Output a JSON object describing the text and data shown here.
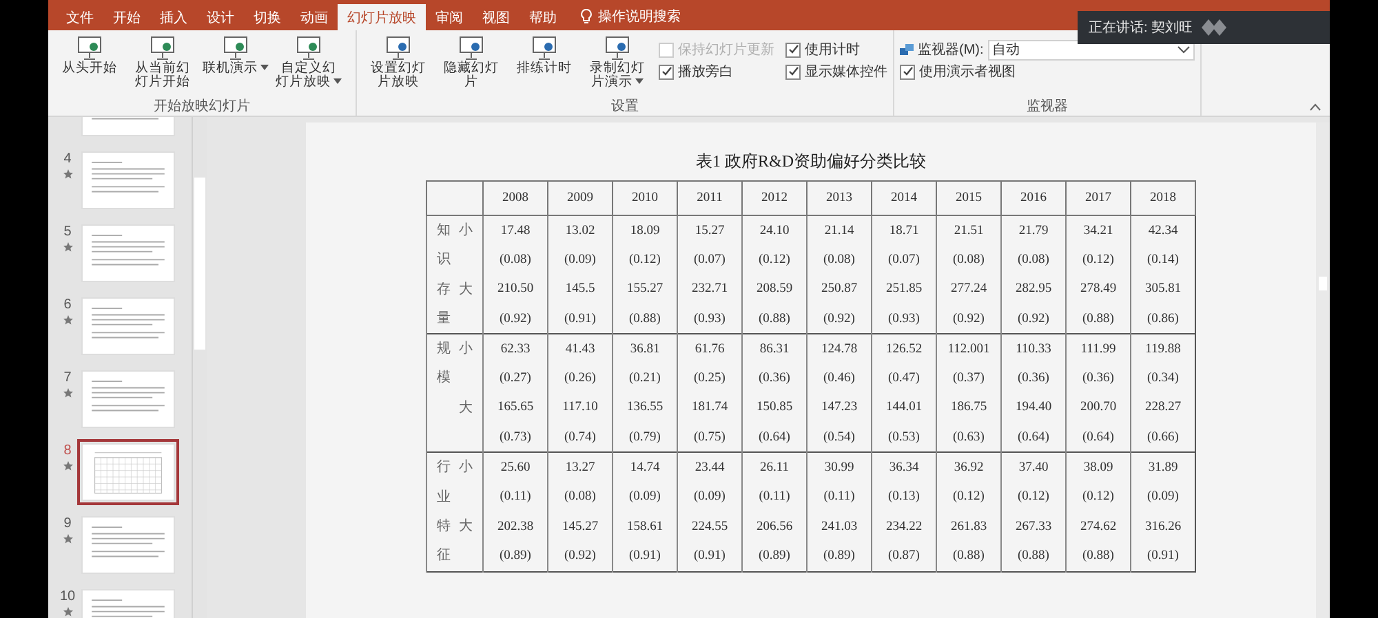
{
  "tabs": [
    {
      "label": "文件",
      "selected": false
    },
    {
      "label": "开始",
      "selected": false
    },
    {
      "label": "插入",
      "selected": false
    },
    {
      "label": "设计",
      "selected": false
    },
    {
      "label": "切换",
      "selected": false
    },
    {
      "label": "动画",
      "selected": false
    },
    {
      "label": "幻灯片放映",
      "selected": true
    },
    {
      "label": "审阅",
      "selected": false
    },
    {
      "label": "视图",
      "selected": false
    },
    {
      "label": "帮助",
      "selected": false
    }
  ],
  "search": {
    "placeholder": "操作说明搜索"
  },
  "speaking_tooltip": {
    "text": "正在讲话: 契刘旺"
  },
  "ribbon": {
    "groups": [
      {
        "label": "开始放映幻灯片",
        "items": [
          {
            "kind": "button",
            "label": "从头开始",
            "dropdown": false
          },
          {
            "kind": "button",
            "label": "从当前幻灯片开始",
            "dropdown": false
          },
          {
            "kind": "button",
            "label": "联机演示",
            "dropdown": true
          },
          {
            "kind": "button",
            "label": "自定义幻灯片放映",
            "dropdown": true
          }
        ]
      },
      {
        "label": "设置",
        "items": [
          {
            "kind": "button",
            "label": "设置幻灯片放映",
            "dropdown": false
          },
          {
            "kind": "button",
            "label": "隐藏幻灯片",
            "dropdown": false
          },
          {
            "kind": "button",
            "label": "排练计时",
            "dropdown": false
          },
          {
            "kind": "button",
            "label": "录制幻灯片演示",
            "dropdown": true
          },
          {
            "kind": "checkbox",
            "label": "保持幻灯片更新",
            "checked": false,
            "disabled": true
          },
          {
            "kind": "checkbox",
            "label": "播放旁白",
            "checked": true,
            "disabled": false
          },
          {
            "kind": "checkbox",
            "label": "使用计时",
            "checked": true,
            "disabled": false
          },
          {
            "kind": "checkbox",
            "label": "显示媒体控件",
            "checked": true,
            "disabled": false
          }
        ]
      },
      {
        "label": "监视器",
        "items": [
          {
            "kind": "select",
            "label": "监视器(M):",
            "value": "自动"
          },
          {
            "kind": "checkbox",
            "label": "使用演示者视图",
            "checked": true,
            "disabled": false
          }
        ]
      }
    ]
  },
  "thumbnails": [
    {
      "selected": false
    },
    {
      "number": "4",
      "selected": false
    },
    {
      "number": "5",
      "selected": false
    },
    {
      "number": "6",
      "selected": false
    },
    {
      "number": "7",
      "selected": false
    },
    {
      "number": "8",
      "selected": true
    },
    {
      "number": "9",
      "selected": false
    },
    {
      "number": "10",
      "selected": false
    }
  ],
  "slide": {
    "title": "表1 政府R&D资助偏好分类比较",
    "table": {
      "columns": [
        "2008",
        "2009",
        "2010",
        "2011",
        "2012",
        "2013",
        "2014",
        "2015",
        "2016",
        "2017",
        "2018"
      ],
      "groups": [
        {
          "name": "知识存量",
          "rows": [
            {
              "label": "小",
              "values": [
                "17.48",
                "13.02",
                "18.09",
                "15.27",
                "24.10",
                "21.14",
                "18.71",
                "21.51",
                "21.79",
                "34.21",
                "42.34"
              ],
              "shares": [
                "(0.08)",
                "(0.09)",
                "(0.12)",
                "(0.07)",
                "(0.12)",
                "(0.08)",
                "(0.07)",
                "(0.08)",
                "(0.08)",
                "(0.12)",
                "(0.14)"
              ]
            },
            {
              "label": "大",
              "values": [
                "210.50",
                "145.5",
                "155.27",
                "232.71",
                "208.59",
                "250.87",
                "251.85",
                "277.24",
                "282.95",
                "278.49",
                "305.81"
              ],
              "shares": [
                "(0.92)",
                "(0.91)",
                "(0.88)",
                "(0.93)",
                "(0.88)",
                "(0.92)",
                "(0.93)",
                "(0.92)",
                "(0.92)",
                "(0.88)",
                "(0.86)"
              ]
            }
          ]
        },
        {
          "name": "规模",
          "rows": [
            {
              "label": "小",
              "values": [
                "62.33",
                "41.43",
                "36.81",
                "61.76",
                "86.31",
                "124.78",
                "126.52",
                "112.001",
                "110.33",
                "111.99",
                "119.88"
              ],
              "shares": [
                "(0.27)",
                "(0.26)",
                "(0.21)",
                "(0.25)",
                "(0.36)",
                "(0.46)",
                "(0.47)",
                "(0.37)",
                "(0.36)",
                "(0.36)",
                "(0.34)"
              ]
            },
            {
              "label": "大",
              "values": [
                "165.65",
                "117.10",
                "136.55",
                "181.74",
                "150.85",
                "147.23",
                "144.01",
                "186.75",
                "194.40",
                "200.70",
                "228.27"
              ],
              "shares": [
                "(0.73)",
                "(0.74)",
                "(0.79)",
                "(0.75)",
                "(0.64)",
                "(0.54)",
                "(0.53)",
                "(0.63)",
                "(0.64)",
                "(0.64)",
                "(0.66)"
              ]
            }
          ]
        },
        {
          "name": "行业特征",
          "rows": [
            {
              "label": "小",
              "values": [
                "25.60",
                "13.27",
                "14.74",
                "23.44",
                "26.11",
                "30.99",
                "36.34",
                "36.92",
                "37.40",
                "38.09",
                "31.89"
              ],
              "shares": [
                "(0.11)",
                "(0.08)",
                "(0.09)",
                "(0.09)",
                "(0.11)",
                "(0.11)",
                "(0.13)",
                "(0.12)",
                "(0.12)",
                "(0.12)",
                "(0.09)"
              ]
            },
            {
              "label": "大",
              "values": [
                "202.38",
                "145.27",
                "158.61",
                "224.55",
                "206.56",
                "241.03",
                "234.22",
                "261.83",
                "267.33",
                "274.62",
                "316.26"
              ],
              "shares": [
                "(0.89)",
                "(0.92)",
                "(0.91)",
                "(0.91)",
                "(0.89)",
                "(0.89)",
                "(0.87)",
                "(0.88)",
                "(0.88)",
                "(0.88)",
                "(0.91)"
              ]
            }
          ]
        }
      ]
    }
  }
}
